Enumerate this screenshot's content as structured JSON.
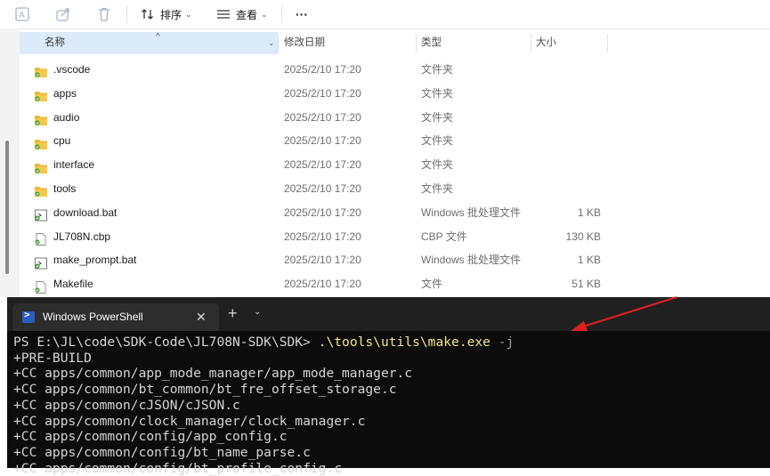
{
  "toolbar": {
    "sort_label": "排序",
    "view_label": "查看",
    "more_label": "···",
    "icons": [
      "rename-icon",
      "share-icon",
      "delete-icon",
      "sort-icon",
      "view-icon",
      "more-icon"
    ]
  },
  "columns": {
    "name": "名称",
    "date": "修改日期",
    "type": "类型",
    "size": "大小"
  },
  "files": [
    {
      "name": ".vscode",
      "date": "2025/2/10 17:20",
      "type": "文件夹",
      "size": "",
      "icon": "folder-icon"
    },
    {
      "name": "apps",
      "date": "2025/2/10 17:20",
      "type": "文件夹",
      "size": "",
      "icon": "folder-icon"
    },
    {
      "name": "audio",
      "date": "2025/2/10 17:20",
      "type": "文件夹",
      "size": "",
      "icon": "folder-icon"
    },
    {
      "name": "cpu",
      "date": "2025/2/10 17:20",
      "type": "文件夹",
      "size": "",
      "icon": "folder-icon"
    },
    {
      "name": "interface",
      "date": "2025/2/10 17:20",
      "type": "文件夹",
      "size": "",
      "icon": "folder-icon"
    },
    {
      "name": "tools",
      "date": "2025/2/10 17:20",
      "type": "文件夹",
      "size": "",
      "icon": "folder-icon"
    },
    {
      "name": "download.bat",
      "date": "2025/2/10 17:20",
      "type": "Windows 批处理文件",
      "size": "1 KB",
      "icon": "batch-file-icon"
    },
    {
      "name": "JL708N.cbp",
      "date": "2025/2/10 17:20",
      "type": "CBP 文件",
      "size": "130 KB",
      "icon": "file-icon"
    },
    {
      "name": "make_prompt.bat",
      "date": "2025/2/10 17:20",
      "type": "Windows 批处理文件",
      "size": "1 KB",
      "icon": "batch-file-icon"
    },
    {
      "name": "Makefile",
      "date": "2025/2/10 17:20",
      "type": "文件",
      "size": "51 KB",
      "icon": "file-icon"
    }
  ],
  "terminal": {
    "tab_title": "Windows PowerShell",
    "close_label": "✕",
    "new_tab_label": "+",
    "dropdown_label": "⌄",
    "prompt": "PS E:\\JL\\code\\SDK-Code\\JL708N-SDK\\SDK> ",
    "command": ".\\tools\\utils\\make.exe",
    "flag": " -j",
    "output": [
      "+PRE-BUILD",
      "+CC apps/common/app_mode_manager/app_mode_manager.c",
      "+CC apps/common/bt_common/bt_fre_offset_storage.c",
      "+CC apps/common/cJSON/cJSON.c",
      "+CC apps/common/clock_manager/clock_manager.c",
      "+CC apps/common/config/app_config.c",
      "+CC apps/common/config/bt_name_parse.c",
      "+CC apps/common/config/bt_profile_config.c"
    ]
  },
  "annotation": {
    "arrow_color": "#e02020"
  }
}
